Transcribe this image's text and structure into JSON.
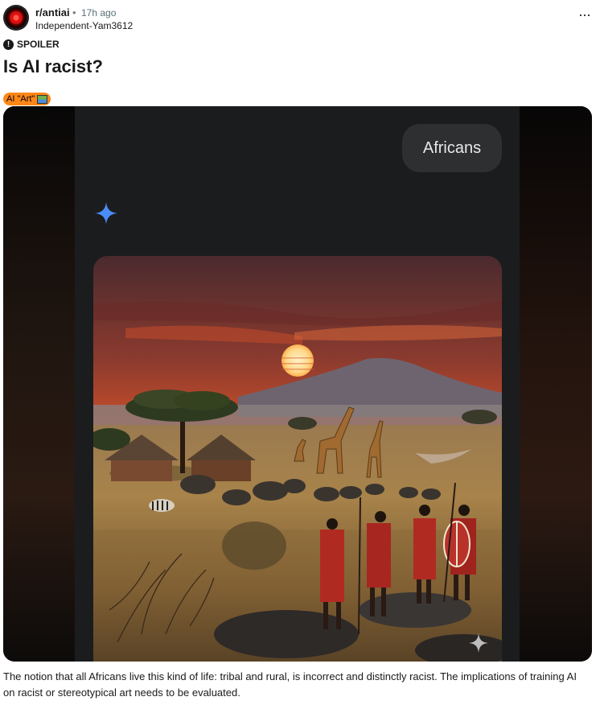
{
  "post": {
    "subreddit": "r/antiai",
    "separator": "•",
    "time_ago": "17h ago",
    "author": "Independent-Yam3612",
    "more_label": "···",
    "spoiler_label": "SPOILER",
    "title": "Is AI racist?",
    "flair_text": "AI \"Art\"",
    "body": "The notion that all Africans live this kind of life: tribal and rural, is incorrect and distinctly racist. The implications of training AI on racist or stereotypical art needs to be evaluated."
  },
  "screenshot": {
    "prompt_text": "Africans",
    "icons": [
      "sparkle-icon",
      "spoiler-icon",
      "more-options-icon"
    ]
  },
  "colors": {
    "flair_bg": "#ff8717",
    "chat_bg": "#1b1c1e",
    "bubble_bg": "#2e2f31",
    "gemini_blue": "#4285f4"
  }
}
